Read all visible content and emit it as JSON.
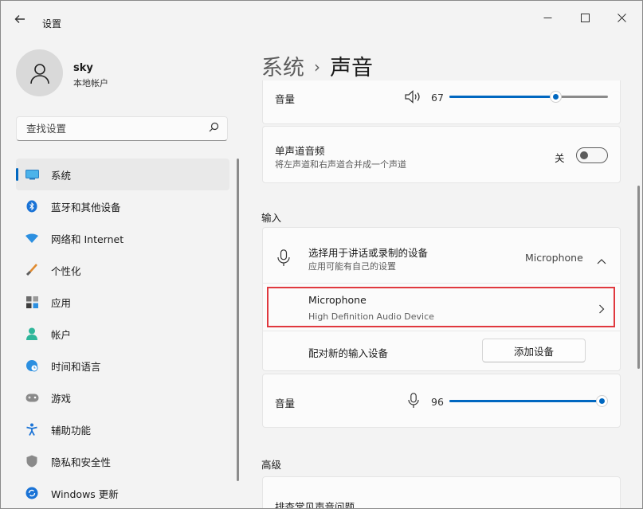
{
  "window": {
    "title": "设置"
  },
  "user": {
    "name": "sky",
    "account_type": "本地帐户"
  },
  "search": {
    "placeholder": "查找设置"
  },
  "nav": [
    {
      "label": "系统",
      "icon": "monitor-icon",
      "active": true
    },
    {
      "label": "蓝牙和其他设备",
      "icon": "bluetooth-icon"
    },
    {
      "label": "网络和 Internet",
      "icon": "wifi-icon"
    },
    {
      "label": "个性化",
      "icon": "brush-icon"
    },
    {
      "label": "应用",
      "icon": "apps-icon"
    },
    {
      "label": "帐户",
      "icon": "person-icon"
    },
    {
      "label": "时间和语言",
      "icon": "clock-globe-icon"
    },
    {
      "label": "游戏",
      "icon": "gamepad-icon"
    },
    {
      "label": "辅助功能",
      "icon": "accessibility-icon"
    },
    {
      "label": "隐私和安全性",
      "icon": "shield-icon"
    },
    {
      "label": "Windows 更新",
      "icon": "sync-icon"
    }
  ],
  "breadcrumb": {
    "parent": "系统",
    "current": "声音"
  },
  "output_volume": {
    "label": "音量",
    "value": "67",
    "level": 0.67
  },
  "mono_audio": {
    "title": "单声道音频",
    "desc": "将左声道和右声道合并成一个声道",
    "state": "关"
  },
  "input_section": {
    "heading": "输入"
  },
  "input_device": {
    "title": "选择用于讲话或录制的设备",
    "desc": "应用可能有自己的设置",
    "selected": "Microphone"
  },
  "microphone": {
    "name": "Microphone",
    "desc": "High Definition Audio Device"
  },
  "pair": {
    "label": "配对新的输入设备",
    "button": "添加设备"
  },
  "input_volume": {
    "label": "音量",
    "value": "96",
    "level": 0.96
  },
  "advanced": {
    "heading": "高级",
    "troubleshoot": "排查常见声音问题"
  },
  "colors": {
    "accent": "#0067c0",
    "highlight": "#e0383e"
  }
}
